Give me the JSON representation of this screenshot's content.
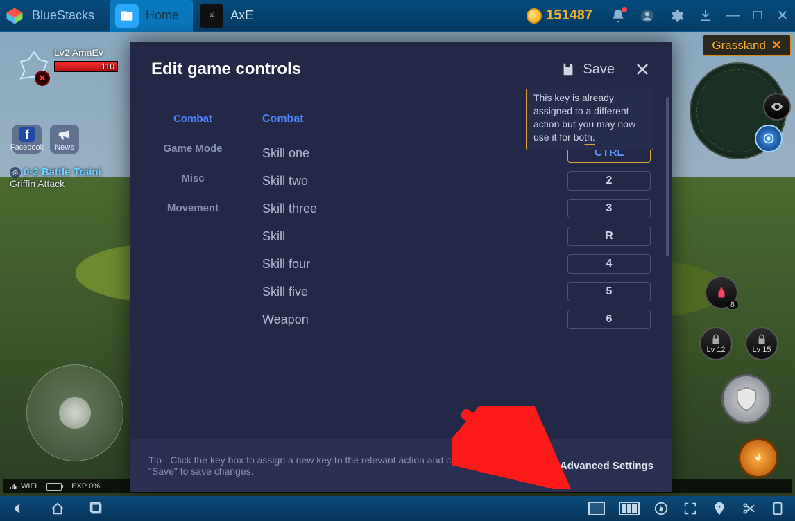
{
  "titlebar": {
    "app_name": "BlueStacks",
    "tabs": [
      {
        "label": "Home"
      },
      {
        "label": "AxE"
      }
    ],
    "coins": "151487"
  },
  "game": {
    "player_level_name": "Lv2 AmaEv",
    "hp_value": "110",
    "facebook_label": "Facebook",
    "news_label": "News",
    "quest_title": "0-2 Battle Traini",
    "quest_sub": "Griffin Attack",
    "zone": "Grassland",
    "potion_count": "8",
    "lock12": "Lv 12",
    "lock15": "Lv 15",
    "wifi": "WIFI",
    "exp_label": "EXP 0%"
  },
  "modal": {
    "title": "Edit game controls",
    "save_label": "Save",
    "sidebar": [
      "Combat",
      "Game Mode",
      "Misc",
      "Movement"
    ],
    "section": "Combat",
    "tooltip": "This key is already assigned to a different action but you may now use it for both.",
    "rows": [
      {
        "label": "Skill one",
        "key": "CTRL",
        "highlight": true
      },
      {
        "label": "Skill two",
        "key": "2"
      },
      {
        "label": "Skill three",
        "key": "3"
      },
      {
        "label": "Skill",
        "key": "R"
      },
      {
        "label": "Skill four",
        "key": "4"
      },
      {
        "label": "Skill five",
        "key": "5"
      },
      {
        "label": "Weapon",
        "key": "6"
      }
    ],
    "tip": "Tip - Click the key box to assign a new key to the relevant action and click \"Save\" to save changes.",
    "advanced_label": "Advanced Settings"
  }
}
